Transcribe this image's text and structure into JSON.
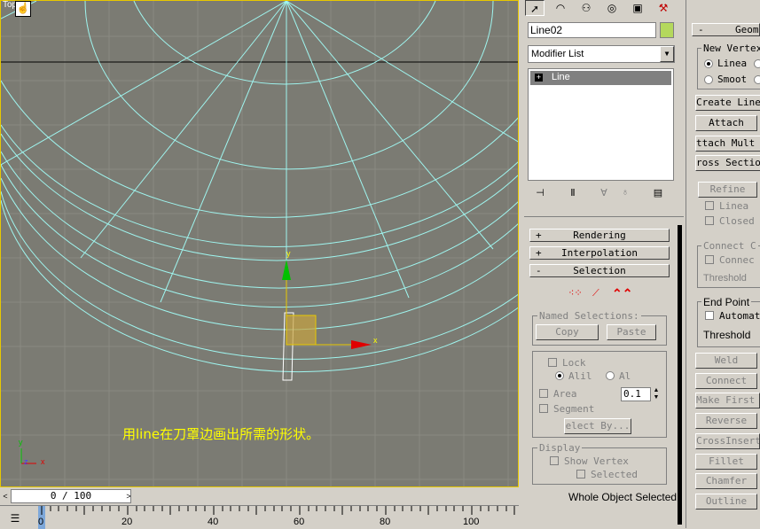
{
  "viewport": {
    "label": "Top",
    "caption": "用line在刀罩边画出所需的形状。",
    "gizmo": {
      "x_label": "x",
      "y_label": "y"
    },
    "axis": {
      "x_label": "x",
      "y_label": "y",
      "z_label": "z"
    }
  },
  "timeline": {
    "slider_text": "0 / 100",
    "ticks": [
      "0",
      "20",
      "40",
      "60",
      "80",
      "100"
    ]
  },
  "command_panel": {
    "tabs": [
      "create-icon",
      "modify-icon",
      "hierarchy-icon",
      "motion-icon",
      "display-icon",
      "utilities-icon"
    ],
    "object_name": "Line02",
    "object_color": "#b4d85c",
    "modifier_list": "Modifier List",
    "stack_items": [
      "Line"
    ],
    "rollouts": {
      "rendering": "Rendering",
      "interpolation": "Interpolation",
      "selection": "Selection",
      "rendering_sign": "+",
      "interpolation_sign": "+",
      "selection_sign": "-"
    },
    "selection": {
      "named_selections": "Named Selections:",
      "copy": "Copy",
      "paste": "Paste",
      "lock": "Lock",
      "all": "Alil",
      "al": "Al",
      "area": "Area",
      "area_value": "0.1",
      "segment": "Segment",
      "select_by": "elect By...",
      "display": "Display",
      "show_vertex": "Show Vertex",
      "selected": "Selected",
      "status": "Whole Object Selected"
    }
  },
  "geometry_panel": {
    "header_sign": "-",
    "header": "Geom",
    "new_vertex": "New Vertex",
    "linear": "Linea",
    "smooth": "Smoot",
    "create_line": "Create Line",
    "attach": "Attach",
    "attach_mult": "ttach Mult",
    "cross_section": "ross Sectio",
    "refine": "Refine",
    "linear2": "Linea",
    "closed": "Closed",
    "connect_copy": "Connect C",
    "connect": "Connec",
    "threshold": "Threshold",
    "end_point": "End Point",
    "automatic": "Automat",
    "threshold2": "Threshold",
    "weld": "Weld",
    "connect_btn": "Connect",
    "make_first": "Make First",
    "reverse": "Reverse",
    "cross_insert": "CrossInsert",
    "fillet": "Fillet",
    "chamfer": "Chamfer",
    "outline": "Outline"
  }
}
